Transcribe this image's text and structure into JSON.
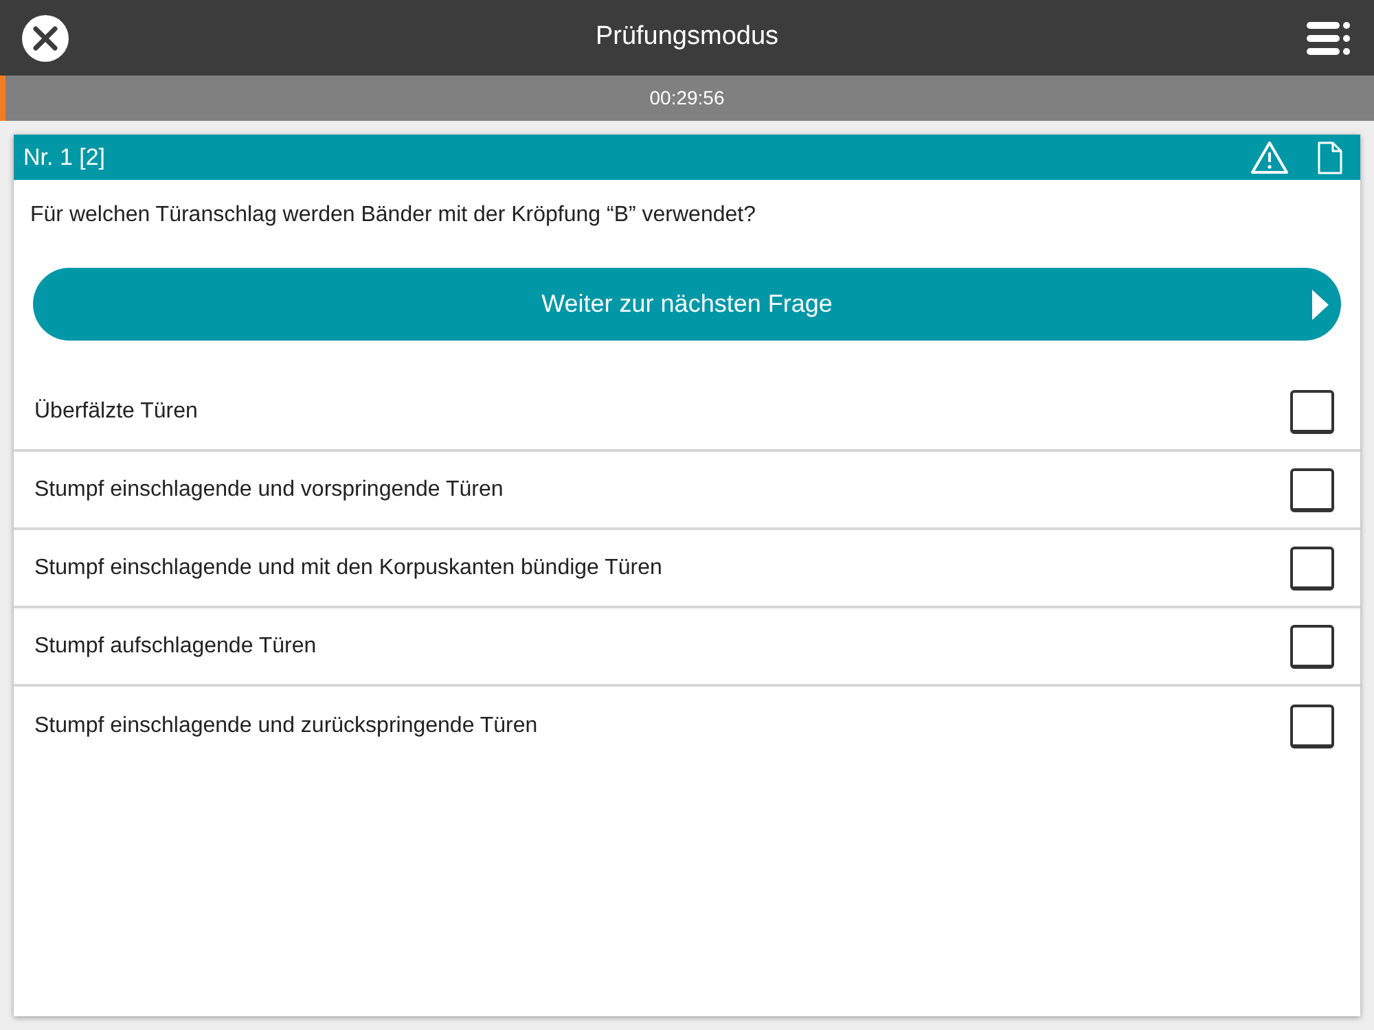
{
  "header": {
    "title": "Prüfungsmodus"
  },
  "timer": {
    "time": "00:29:56",
    "level": 0.004
  },
  "question": {
    "number": "Nr. 1 [2]",
    "text": "Für welchen Türanschlag werden Bänder mit der Kröpfung “B” verwendet?",
    "next_button": "Weiter zur nächsten Frage"
  },
  "answers": [
    {
      "text": "Überfälzte Türen",
      "checked": false
    },
    {
      "text": "Stumpf einschlagende und vorspringende Türen",
      "checked": false
    },
    {
      "text": "Stumpf einschlagende und mit den Korpuskanten bündige Türen",
      "checked": false
    },
    {
      "text": "Stumpf aufschlagende Türen",
      "checked": false
    },
    {
      "text": "Stumpf einschlagende und zurückspringende Türen",
      "checked": false
    }
  ]
}
